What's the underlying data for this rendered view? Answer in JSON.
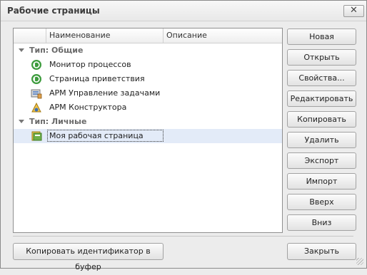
{
  "window": {
    "title": "Рабочие страницы",
    "close_glyph": "✕"
  },
  "grid": {
    "columns": [
      "Наименование",
      "Описание"
    ],
    "groups": [
      {
        "label": "Тип: Общие"
      },
      {
        "label": "Тип: Личные"
      }
    ],
    "rows": [
      {
        "label": "Монитор процессов",
        "icon": "process-monitor-icon"
      },
      {
        "label": "Страница приветствия",
        "icon": "welcome-page-icon"
      },
      {
        "label": "АРМ Управление задачами",
        "icon": "task-management-icon"
      },
      {
        "label": "АРМ Конструктора",
        "icon": "designer-icon"
      },
      {
        "label": "Моя рабочая страница",
        "icon": "my-workpage-icon",
        "selected": true
      }
    ]
  },
  "buttons": {
    "new": "Новая",
    "open": "Открыть",
    "properties": "Свойства...",
    "edit": "Редактировать",
    "copy": "Копировать",
    "delete": "Удалить",
    "export": "Экспорт",
    "import": "Импорт",
    "up": "Вверх",
    "down": "Вниз",
    "copy_id": "Копировать идентификатор в буфер",
    "close": "Закрыть"
  },
  "colors": {
    "selected_row": "#e3ebf8",
    "green_icon": "#3c9b3c"
  }
}
